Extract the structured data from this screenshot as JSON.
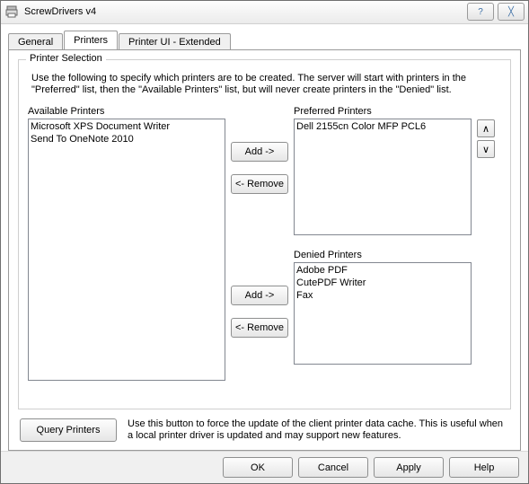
{
  "window": {
    "title": "ScrewDrivers v4",
    "icon_name": "printer-driver-icon"
  },
  "tabs": {
    "general": "General",
    "printers": "Printers",
    "printer_ui_ext": "Printer UI - Extended",
    "active_index": 1
  },
  "group": {
    "legend": "Printer Selection",
    "instructions": "Use the following to specify which printers are to be created.  The server will start with printers in the \"Preferred\" list, then the \"Available Printers\" list, but will never create printers in the \"Denied\" list."
  },
  "labels": {
    "available": "Available Printers",
    "preferred": "Preferred Printers",
    "denied": "Denied Printers"
  },
  "available_printers": [
    "Microsoft XPS Document Writer",
    "Send To OneNote 2010"
  ],
  "preferred_printers": [
    "Dell 2155cn Color MFP PCL6"
  ],
  "denied_printers": [
    "Adobe PDF",
    "CutePDF Writer",
    "Fax"
  ],
  "buttons": {
    "add": "Add ->",
    "remove": "<- Remove",
    "move_up_glyph": "∧",
    "move_down_glyph": "∨",
    "query": "Query Printers",
    "ok": "OK",
    "cancel": "Cancel",
    "apply": "Apply",
    "help": "Help"
  },
  "query_text": "Use this button to force the update of the client printer data cache.  This is useful when a local printer driver is updated and may support new features.",
  "titlebar_glyphs": {
    "help": "?",
    "close": "╳"
  }
}
